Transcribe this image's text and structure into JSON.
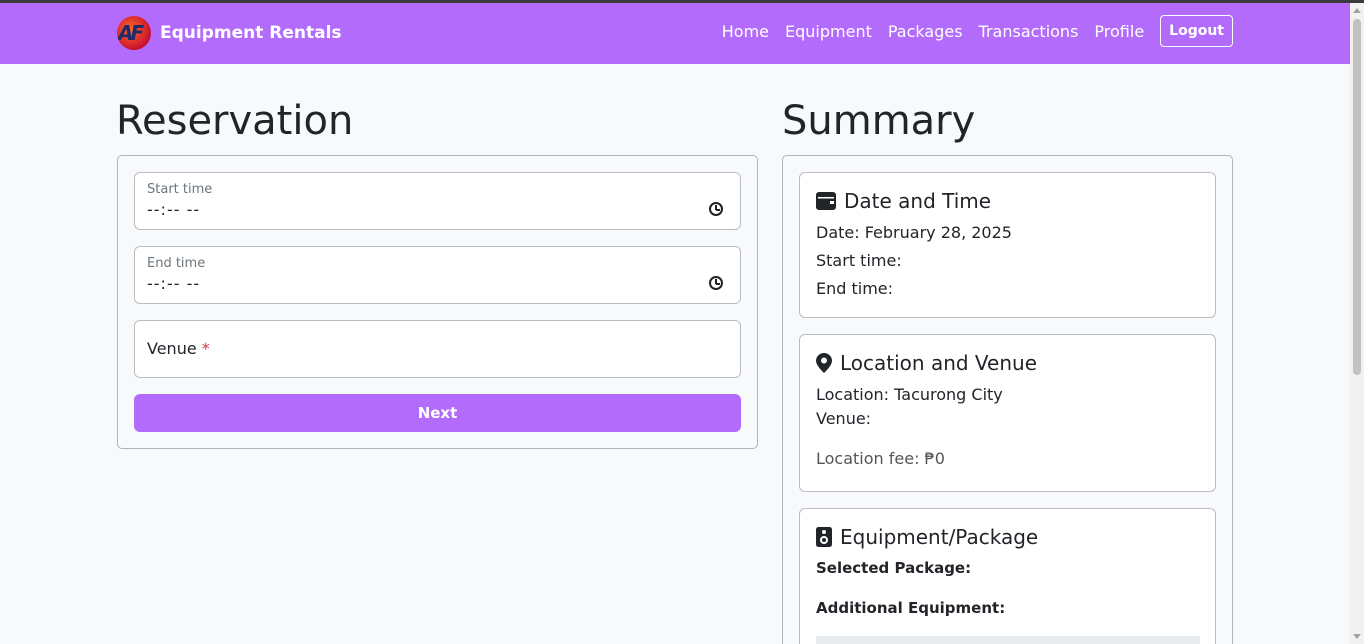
{
  "navbar": {
    "brand_logo_text": "AF",
    "brand": "Equipment Rentals",
    "links": [
      "Home",
      "Equipment",
      "Packages",
      "Transactions",
      "Profile"
    ],
    "logout": "Logout",
    "bg_color": "#b36bfb"
  },
  "reservation": {
    "heading": "Reservation",
    "start_time": {
      "label": "Start time",
      "value": "--:-- --"
    },
    "end_time": {
      "label": "End time",
      "value": "--:-- --"
    },
    "venue": {
      "label": "Venue",
      "required_mark": "*"
    },
    "next_label": "Next"
  },
  "summary": {
    "heading": "Summary",
    "date_time": {
      "title": "Date and Time",
      "date": "Date: February 28, 2025",
      "start": "Start time:",
      "end": "End time:"
    },
    "location": {
      "title": "Location and Venue",
      "location": "Location: Tacurong City",
      "venue": "Venue:",
      "fee": "Location fee: ₱0"
    },
    "equipment": {
      "title": "Equipment/Package",
      "selected_package": "Selected Package:",
      "additional_equipment": "Additional Equipment:"
    }
  },
  "icons": [
    "calendar-icon",
    "map-pin-icon",
    "speaker-icon",
    "clock-icon"
  ]
}
